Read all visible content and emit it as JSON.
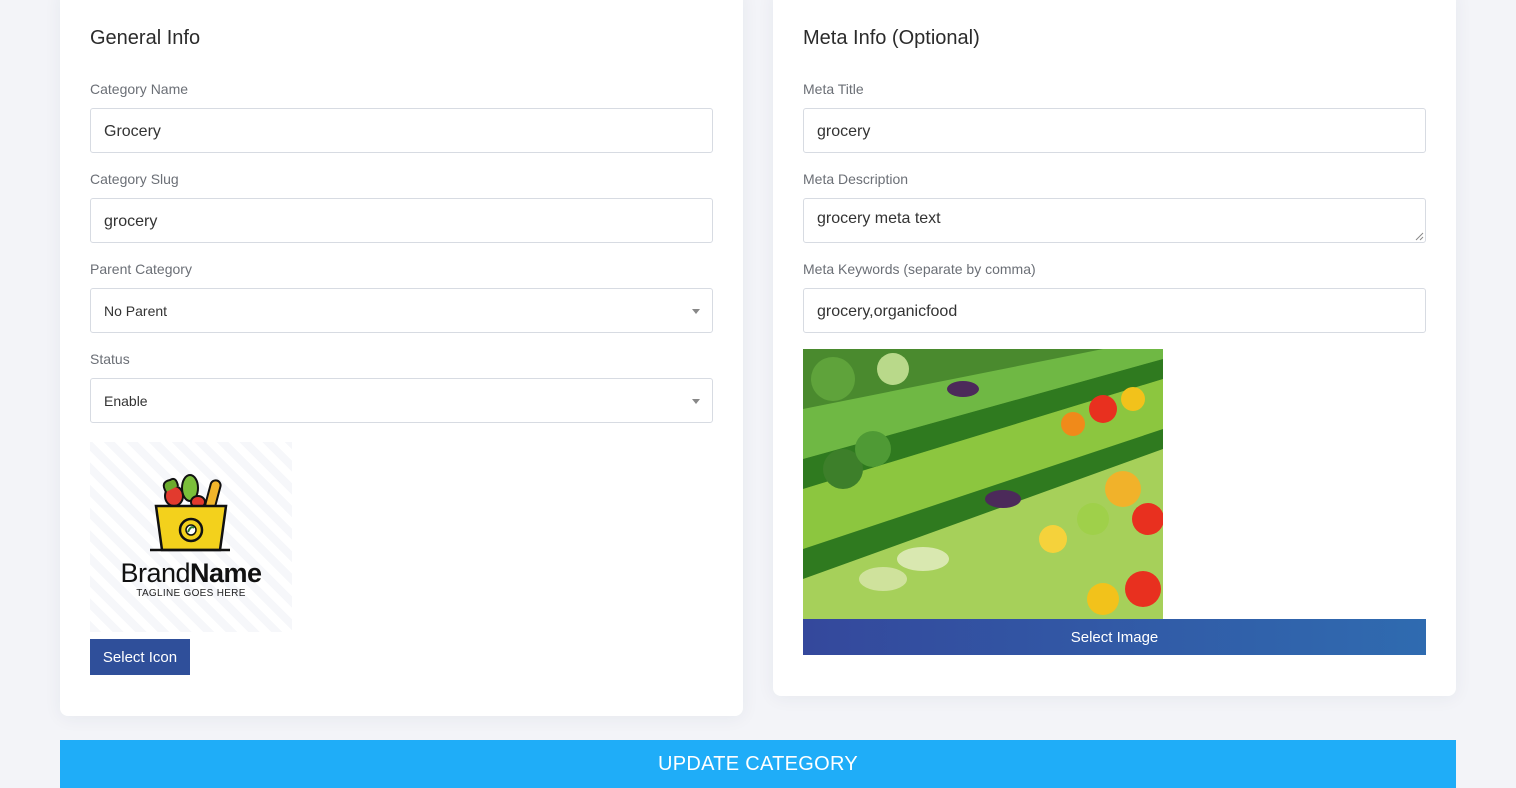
{
  "general": {
    "title": "General Info",
    "category_name_label": "Category Name",
    "category_name_value": "Grocery",
    "category_slug_label": "Category Slug",
    "category_slug_value": "grocery",
    "parent_category_label": "Parent Category",
    "parent_category_value": "No Parent",
    "status_label": "Status",
    "status_value": "Enable",
    "logo": {
      "brand_light": "Brand",
      "brand_bold": "Name",
      "tagline": "TAGLINE GOES HERE"
    },
    "select_icon_label": "Select Icon"
  },
  "meta": {
    "title": "Meta Info (Optional)",
    "meta_title_label": "Meta Title",
    "meta_title_value": "grocery",
    "meta_description_label": "Meta Description",
    "meta_description_value": "grocery meta text",
    "meta_keywords_label": "Meta Keywords (separate by comma)",
    "meta_keywords_value": "grocery,organicfood",
    "select_image_label": "Select Image"
  },
  "update_button_label": "UPDATE CATEGORY",
  "colors": {
    "page_bg": "#f3f4f8",
    "primary_button": "#2f4f9a",
    "update_button": "#1fadf8"
  }
}
